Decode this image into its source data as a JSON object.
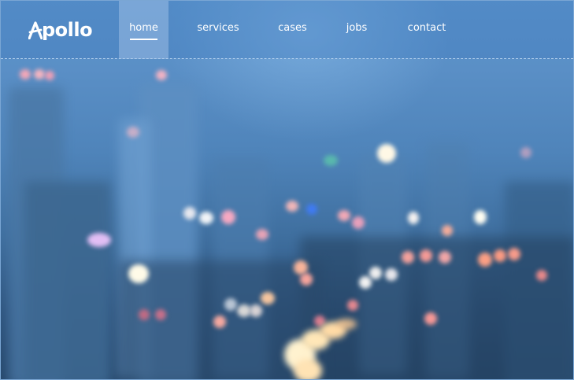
{
  "brand": {
    "logo_text": "pollo",
    "logo_icon": "apollo-a-logo-icon"
  },
  "nav": {
    "items": [
      {
        "label": "home",
        "active": true
      },
      {
        "label": "services",
        "active": false
      },
      {
        "label": "cases",
        "active": false
      },
      {
        "label": "jobs",
        "active": false
      },
      {
        "label": "contact",
        "active": false
      }
    ]
  },
  "hero": {
    "background": "blurred-city-night-bokeh-hearts"
  },
  "colors": {
    "accent": "#ffffff",
    "sky": "#5a8fc6",
    "nav_active": "#9fbde0"
  }
}
